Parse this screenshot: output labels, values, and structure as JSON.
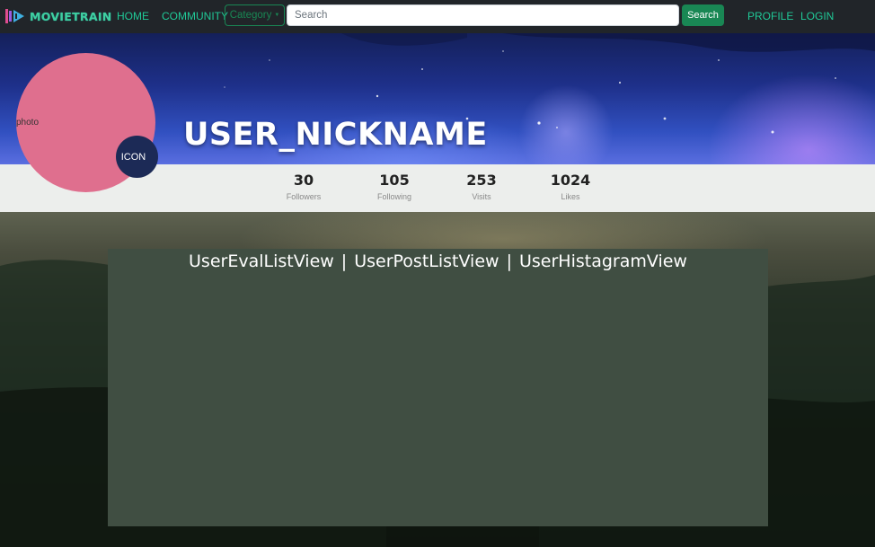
{
  "navbar": {
    "brand": "MOVIETRAIN",
    "links": {
      "home": "HOME",
      "community": "COMMUNITY",
      "profile": "PROFILE",
      "login": "LOGIN"
    },
    "category_label": "Category",
    "search": {
      "placeholder": "Search",
      "value": "",
      "button_label": "Search"
    }
  },
  "profile": {
    "photo_label": "photo",
    "icon_label": "ICON",
    "nickname": "USER_NICKNAME"
  },
  "stats": [
    {
      "value": "30",
      "label": "Followers"
    },
    {
      "value": "105",
      "label": "Following"
    },
    {
      "value": "253",
      "label": "Visits"
    },
    {
      "value": "1024",
      "label": "Likes"
    }
  ],
  "content": {
    "tabs": [
      "UserEvalListView",
      "UserPostListView",
      "UserHistagramView"
    ],
    "separator": "|"
  },
  "colors": {
    "navbar_bg": "#212529",
    "accent_teal": "#20c997",
    "success_green": "#198754",
    "photo_pink": "#df6f8e",
    "icon_navy": "#1c2a56",
    "panel_green": "#404e42"
  }
}
